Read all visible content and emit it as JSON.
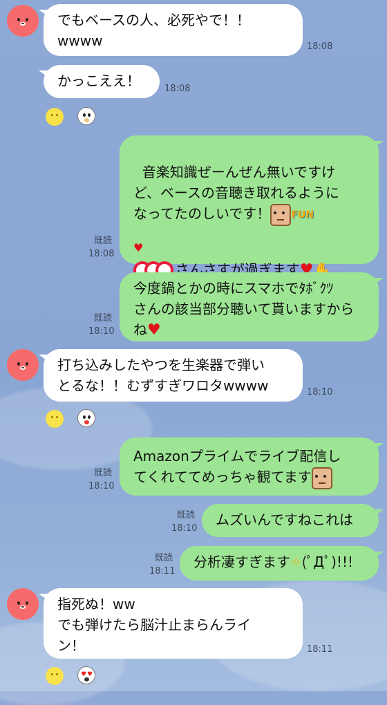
{
  "messages": [
    {
      "id": "m1",
      "dir": "in",
      "lines": "でもベースの人、必死やで！！\nwwww",
      "time": "18:08"
    },
    {
      "id": "m2",
      "dir": "in",
      "lines": "かっこええ！",
      "time": "18:08"
    },
    {
      "id": "m3",
      "dir": "out",
      "text1": "音楽知識ぜーんぜん無いですけ\nど、ベースの音聴き取れるように\nなってたのしいです！",
      "text2": "さんさすが過ぎます",
      "read": "既読",
      "time": "18:08"
    },
    {
      "id": "m4",
      "dir": "out",
      "lines": "今度鍋とかの時にスマホでﾀﾎﾞｸﾂ\nさんの該当部分聴いて貰いますから\nね",
      "read": "既読",
      "time": "18:10"
    },
    {
      "id": "m5",
      "dir": "in",
      "lines": "打ち込みしたやつを生楽器で弾い\nとるな！！むずすぎワロタwwww",
      "time": "18:10"
    },
    {
      "id": "m6",
      "dir": "out",
      "lines": "Amazonプライムでライブ配信し\nてくれててめっちゃ観てます",
      "read": "既読",
      "time": "18:10"
    },
    {
      "id": "m7",
      "dir": "out",
      "lines": "ムズいんですねこれは",
      "read": "既読",
      "time": "18:10"
    },
    {
      "id": "m8",
      "dir": "out",
      "text1": "分析凄すぎます",
      "text2": "(ﾟДﾟ)!!!",
      "read": "既読",
      "time": "18:11"
    },
    {
      "id": "m9",
      "dir": "in",
      "lines": "指死ぬ！ww\nでも弾けたら脳汁止まらんライ\nン！",
      "time": "18:11"
    }
  ],
  "emoji": {
    "fun": "FUN",
    "heart": "♥",
    "sparkle": "✧",
    "clap": "✋"
  },
  "colors": {
    "incoming": "#ffffff",
    "outgoing": "#9de594",
    "background": "#8fa9d6",
    "avatar": "#f56b6b"
  }
}
